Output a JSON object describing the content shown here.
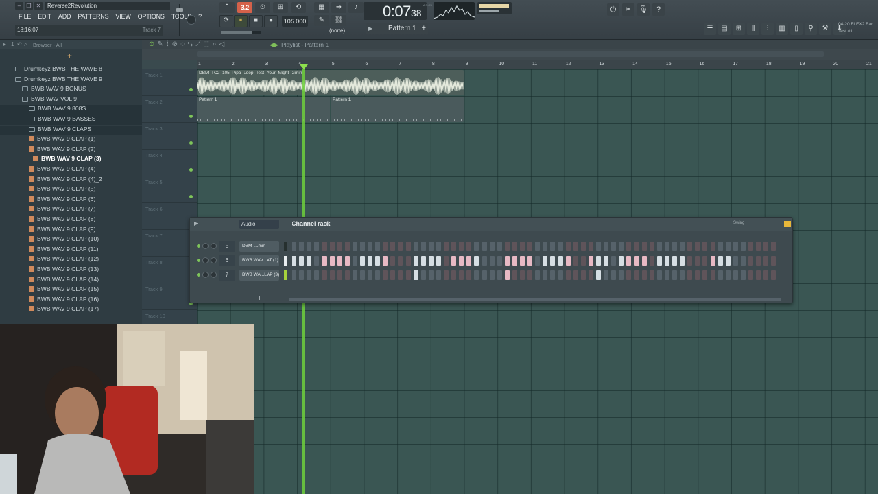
{
  "window": {
    "song_title": "Reverse2Revolution",
    "hint_time": "18:16:07",
    "hint_track": "Track 7"
  },
  "menu": [
    "FILE",
    "EDIT",
    "ADD",
    "PATTERNS",
    "VIEW",
    "OPTIONS",
    "TOOLS",
    "?"
  ],
  "transport": {
    "tempo": "105.000",
    "time_main": "0:07",
    "time_seconds": "38",
    "time_label": "M:S:CS",
    "countdown": "3.2",
    "snap": "(none)",
    "pattern": "Pattern 1",
    "tempo_slider_fraction": 0.8
  },
  "news": {
    "line1": "04-20  FLEX2 Bar",
    "line2": "Test #1"
  },
  "browser": {
    "title": "Browser - All",
    "items": [
      {
        "label": "Drumkeyz BWB THE WAVE 8",
        "type": "folder",
        "level": 0
      },
      {
        "label": "Drumkeyz BWB THE WAVE 9",
        "type": "folder",
        "level": 0
      },
      {
        "label": "BWB WAV 9 BONUS",
        "type": "folder",
        "level": 1
      },
      {
        "label": "BWB WAV VOL 9",
        "type": "folder",
        "level": 1
      },
      {
        "label": "BWB WAV 9 808S",
        "type": "folder",
        "level": 2
      },
      {
        "label": "BWB WAV 9 BASSES",
        "type": "folder",
        "level": 2
      },
      {
        "label": "BWB WAV 9 CLAPS",
        "type": "folder",
        "level": 2
      },
      {
        "label": "BWB WAV 9 CLAP (1)",
        "type": "wave",
        "level": 2
      },
      {
        "label": "BWB WAV 9 CLAP (2)",
        "type": "wave",
        "level": 2
      },
      {
        "label": "BWB WAV 9 CLAP (3)",
        "type": "wave",
        "level": 3,
        "selected": true
      },
      {
        "label": "BWB WAV 9 CLAP (4)",
        "type": "wave",
        "level": 2
      },
      {
        "label": "BWB WAV 9 CLAP (4)_2",
        "type": "wave",
        "level": 2
      },
      {
        "label": "BWB WAV 9 CLAP (5)",
        "type": "wave",
        "level": 2
      },
      {
        "label": "BWB WAV 9 CLAP (6)",
        "type": "wave",
        "level": 2
      },
      {
        "label": "BWB WAV 9 CLAP (7)",
        "type": "wave",
        "level": 2
      },
      {
        "label": "BWB WAV 9 CLAP (8)",
        "type": "wave",
        "level": 2
      },
      {
        "label": "BWB WAV 9 CLAP (9)",
        "type": "wave",
        "level": 2
      },
      {
        "label": "BWB WAV 9 CLAP (10)",
        "type": "wave",
        "level": 2
      },
      {
        "label": "BWB WAV 9 CLAP (11)",
        "type": "wave",
        "level": 2
      },
      {
        "label": "BWB WAV 9 CLAP (12)",
        "type": "wave",
        "level": 2
      },
      {
        "label": "BWB WAV 9 CLAP (13)",
        "type": "wave",
        "level": 2
      },
      {
        "label": "BWB WAV 9 CLAP (14)",
        "type": "wave",
        "level": 2
      },
      {
        "label": "BWB WAV 9 CLAP (15)",
        "type": "wave",
        "level": 2
      },
      {
        "label": "BWB WAV 9 CLAP (16)",
        "type": "wave",
        "level": 2
      },
      {
        "label": "BWB WAV 9 CLAP (17)",
        "type": "wave",
        "level": 2
      }
    ]
  },
  "playlist": {
    "title": "Playlist - Pattern 1",
    "bars": [
      "1",
      "2",
      "3",
      "4",
      "5",
      "6",
      "7",
      "8",
      "9",
      "10",
      "11",
      "12",
      "13",
      "14",
      "15",
      "16",
      "17",
      "18",
      "19",
      "20",
      "21"
    ],
    "tracks": [
      "Track 1",
      "Track 2",
      "Track 3",
      "Track 4",
      "Track 5",
      "Track 6",
      "Track 7",
      "Track 8",
      "Track 9",
      "Track 10"
    ],
    "audio_clip": "DBM_TC2_105_Pipa_Loop_Test_Your_Might_Gmin",
    "pattern_clips": [
      "Pattern 1",
      "Pattern 1"
    ],
    "playhead_bar": 4.2
  },
  "channel_rack": {
    "title": "Channel rack",
    "filter": "Audio",
    "swing_label": "Swing",
    "channels": [
      {
        "num": "5",
        "name": "DBM_...min",
        "steps": ""
      },
      {
        "num": "6",
        "name": "BWB WAV...AT (1)",
        "steps": "1110111101111000111101111000111101111001110111101111000111"
      },
      {
        "num": "7",
        "name": "BWB WA...LAP (3)",
        "steps": "0000000000000000100000000000100000000000100000000000000000"
      }
    ]
  },
  "colors": {
    "accent_green": "#6fcf3c",
    "step_on_light": "#d6dee3",
    "step_on_pink": "#e7b9c4",
    "countdown_red": "#d4614a"
  },
  "icons": {
    "play": "play-icon",
    "stop": "stop-icon",
    "record": "record-icon",
    "loop": "loop-icon"
  }
}
